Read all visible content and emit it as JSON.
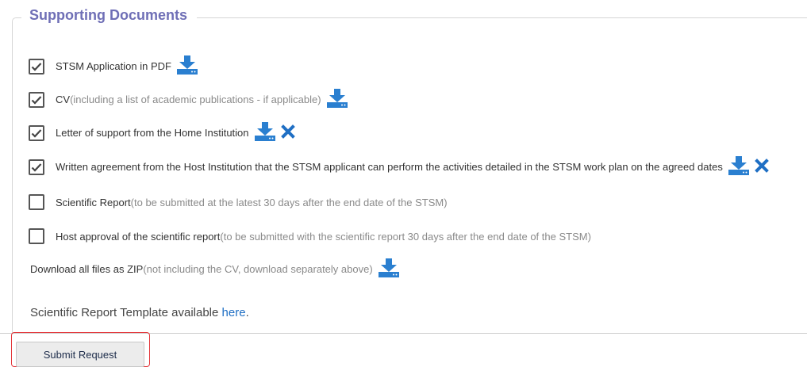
{
  "section": {
    "legend": "Supporting Documents"
  },
  "documents": [
    {
      "checked": true,
      "label": "STSM Application in PDF",
      "note": "",
      "download": true,
      "remove": false
    },
    {
      "checked": true,
      "label": "CV",
      "note": " (including a list of academic publications - if applicable)",
      "download": true,
      "remove": false
    },
    {
      "checked": true,
      "label": "Letter of support from the Home Institution",
      "note": "",
      "download": true,
      "remove": true
    },
    {
      "checked": true,
      "label": "Written agreement from the Host Institution that the STSM applicant can perform the activities detailed in the STSM work plan on the agreed dates",
      "note": "",
      "download": true,
      "remove": true
    },
    {
      "checked": false,
      "label": "Scientific Report",
      "note": " (to be submitted at the latest 30 days after the end date of the STSM)",
      "download": false,
      "remove": false
    },
    {
      "checked": false,
      "label": "Host approval of the scientific report",
      "note": " (to be submitted with the scientific report 30 days after the end date of the STSM)",
      "download": false,
      "remove": false
    }
  ],
  "zip": {
    "label": "Download all files as ZIP",
    "note": " (not including the CV, download separately above)"
  },
  "template": {
    "prefix": "Scientific Report Template available ",
    "link": "here",
    "suffix": "."
  },
  "submit": {
    "label": "Submit Request"
  },
  "colors": {
    "legend": "#6f6fb6",
    "download_icon": "#2a7fd0",
    "remove_icon": "#1f6fc4",
    "link": "#1f6fc4",
    "highlight": "#e3373b"
  },
  "icons": {
    "download": "download-icon",
    "remove": "close-icon",
    "checkbox_checked": "checkmark-icon"
  }
}
